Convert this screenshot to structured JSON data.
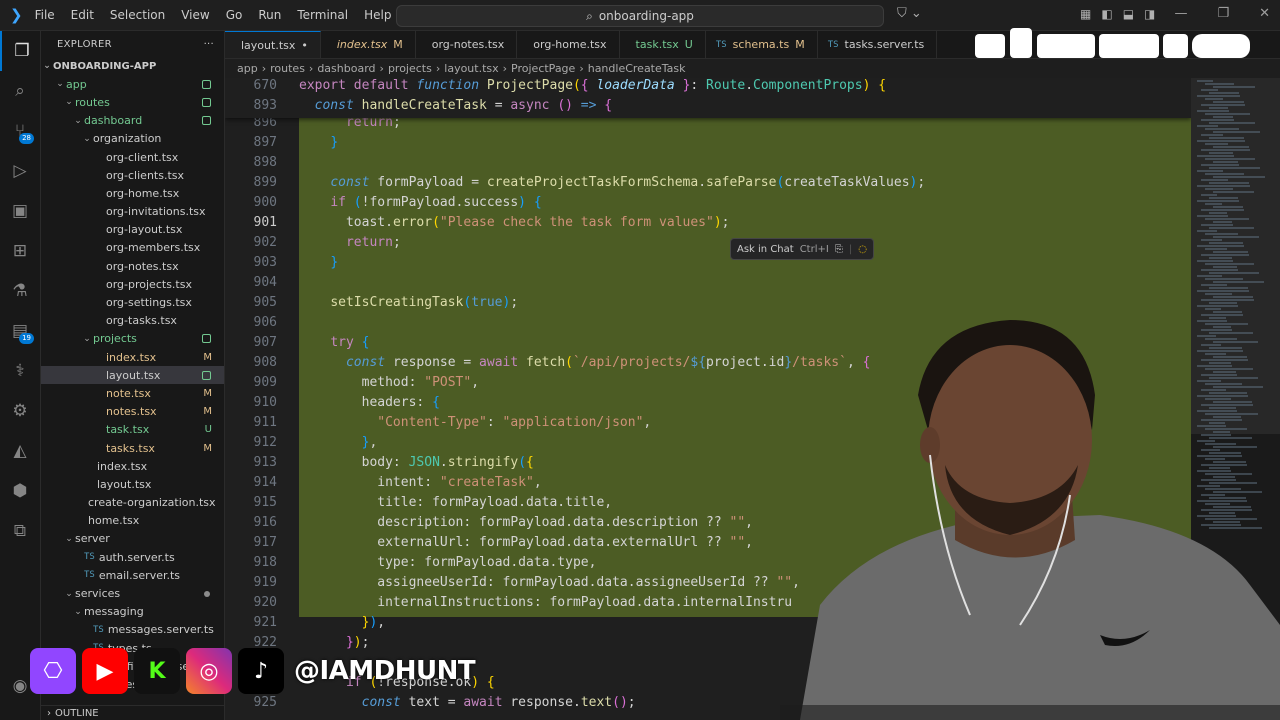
{
  "menu": [
    "File",
    "Edit",
    "Selection",
    "View",
    "Go",
    "Run",
    "Terminal",
    "Help"
  ],
  "search": {
    "text": "onboarding-app"
  },
  "explorer": {
    "title": "EXPLORER",
    "root": "ONBOARDING-APP",
    "tree": [
      {
        "label": "app",
        "depth": 1,
        "type": "folder",
        "open": true,
        "status": "dot"
      },
      {
        "label": "routes",
        "depth": 2,
        "type": "folder",
        "open": true,
        "status": "dot"
      },
      {
        "label": "dashboard",
        "depth": 3,
        "type": "folder",
        "open": true,
        "status": "dot"
      },
      {
        "label": "organization",
        "depth": 4,
        "type": "folder",
        "open": true,
        "status": ""
      },
      {
        "label": "org-client.tsx",
        "depth": 5,
        "type": "file",
        "status": ""
      },
      {
        "label": "org-clients.tsx",
        "depth": 5,
        "type": "file",
        "status": ""
      },
      {
        "label": "org-home.tsx",
        "depth": 5,
        "type": "file",
        "status": ""
      },
      {
        "label": "org-invitations.tsx",
        "depth": 5,
        "type": "file",
        "status": ""
      },
      {
        "label": "org-layout.tsx",
        "depth": 5,
        "type": "file",
        "status": ""
      },
      {
        "label": "org-members.tsx",
        "depth": 5,
        "type": "file",
        "status": ""
      },
      {
        "label": "org-notes.tsx",
        "depth": 5,
        "type": "file",
        "status": ""
      },
      {
        "label": "org-projects.tsx",
        "depth": 5,
        "type": "file",
        "status": ""
      },
      {
        "label": "org-settings.tsx",
        "depth": 5,
        "type": "file",
        "status": ""
      },
      {
        "label": "org-tasks.tsx",
        "depth": 5,
        "type": "file",
        "status": ""
      },
      {
        "label": "projects",
        "depth": 4,
        "type": "folder",
        "open": true,
        "status": "dot"
      },
      {
        "label": "index.tsx",
        "depth": 5,
        "type": "file",
        "status": "M"
      },
      {
        "label": "layout.tsx",
        "depth": 5,
        "type": "file",
        "status": "dot",
        "selected": true
      },
      {
        "label": "note.tsx",
        "depth": 5,
        "type": "file",
        "status": "M"
      },
      {
        "label": "notes.tsx",
        "depth": 5,
        "type": "file",
        "status": "M"
      },
      {
        "label": "task.tsx",
        "depth": 5,
        "type": "file",
        "status": "U"
      },
      {
        "label": "tasks.tsx",
        "depth": 5,
        "type": "file",
        "status": "M"
      },
      {
        "label": "index.tsx",
        "depth": 4,
        "type": "file",
        "status": ""
      },
      {
        "label": "layout.tsx",
        "depth": 4,
        "type": "file",
        "status": ""
      },
      {
        "label": "create-organization.tsx",
        "depth": 3,
        "type": "file",
        "status": ""
      },
      {
        "label": "home.tsx",
        "depth": 3,
        "type": "file",
        "status": ""
      },
      {
        "label": "server",
        "depth": 2,
        "type": "folder",
        "open": true,
        "status": ""
      },
      {
        "label": "auth.server.ts",
        "depth": 3,
        "type": "file",
        "status": ""
      },
      {
        "label": "email.server.ts",
        "depth": 3,
        "type": "file",
        "status": ""
      },
      {
        "label": "services",
        "depth": 2,
        "type": "folder",
        "open": true,
        "status": "gray"
      },
      {
        "label": "messaging",
        "depth": 3,
        "type": "folder",
        "open": true,
        "status": ""
      },
      {
        "label": "messages.server.ts",
        "depth": 4,
        "type": "file",
        "status": ""
      },
      {
        "label": "types.ts",
        "depth": 4,
        "type": "file",
        "status": ""
      },
      {
        "label": "notifications.server.ts",
        "depth": 4,
        "type": "file",
        "status": ""
      },
      {
        "label": "types.ts",
        "depth": 4,
        "type": "file",
        "status": ""
      }
    ],
    "outline": "OUTLINE"
  },
  "activity": {
    "scm_badge": "28",
    "ext_badge": "19"
  },
  "tabs": [
    {
      "label": "layout.tsx",
      "status": "•",
      "active": true
    },
    {
      "label": "index.tsx",
      "status": "M",
      "italic": true
    },
    {
      "label": "org-notes.tsx",
      "status": ""
    },
    {
      "label": "org-home.tsx",
      "status": ""
    },
    {
      "label": "task.tsx",
      "status": "U"
    },
    {
      "label": "schema.ts",
      "status": "M"
    },
    {
      "label": "tasks.server.ts",
      "status": ""
    }
  ],
  "breadcrumbs": [
    "app",
    "routes",
    "dashboard",
    "projects",
    "layout.tsx",
    "ProjectPage",
    "handleCreateTask"
  ],
  "code": {
    "sticky": [
      {
        "ln": "670",
        "html": "<span class='kw2'>export</span> <span class='kw2'>default</span> <span class='kw ital'>function</span> <span class='fn'>ProjectPage</span><span class='br'>(</span><span class='br2'>{</span> <span class='var ital'>loaderData</span> <span class='br2'>}</span><span class='pl'>:</span> <span class='ty'>Route</span><span class='pl'>.</span><span class='ty'>ComponentProps</span><span class='br'>)</span> <span class='br'>{</span>"
      },
      {
        "ln": "893",
        "html": "  <span class='kw ital'>const</span> <span class='fn'>handleCreateTask</span> <span class='pl'>=</span> <span class='kw2'>async</span> <span class='br2'>()</span> <span class='kw'>=&gt;</span> <span class='br2'>{</span>"
      }
    ],
    "lines": [
      {
        "ln": "896",
        "html": "      <span class='kw2'>return</span><span class='pl'>;</span>"
      },
      {
        "ln": "897",
        "html": "    <span class='br3'>}</span>"
      },
      {
        "ln": "898",
        "html": ""
      },
      {
        "ln": "899",
        "html": "    <span class='kw ital'>const</span> <span class='pl'>formPayload</span> <span class='pl'>=</span> <span class='fn'>createProjectTaskFormSchema</span><span class='pl'>.</span><span class='fn'>safeParse</span><span class='br3'>(</span><span class='pl'>createTaskValues</span><span class='br3'>)</span><span class='pl'>;</span>"
      },
      {
        "ln": "900",
        "html": "    <span class='kw2'>if</span> <span class='br3'>(</span><span class='pl'>!</span><span class='pl'>formPayload</span><span class='pl'>.success</span><span class='br3'>)</span> <span class='br3'>{</span>"
      },
      {
        "ln": "901",
        "html": "      <span class='pl'>toast</span><span class='pl'>.</span><span class='fn'>error</span><span class='br'>(</span><span class='str'>\"Please check the task form values\"</span><span class='br'>)</span><span class='pl'>;</span>",
        "current": true
      },
      {
        "ln": "902",
        "html": "      <span class='kw2'>return</span><span class='pl'>;</span>"
      },
      {
        "ln": "903",
        "html": "    <span class='br3'>}</span>"
      },
      {
        "ln": "904",
        "html": ""
      },
      {
        "ln": "905",
        "html": "    <span class='fn'>setIsCreatingTask</span><span class='br3'>(</span><span class='kw'>true</span><span class='br3'>)</span><span class='pl'>;</span>"
      },
      {
        "ln": "906",
        "html": ""
      },
      {
        "ln": "907",
        "html": "    <span class='kw2'>try</span> <span class='br3'>{</span>"
      },
      {
        "ln": "908",
        "html": "      <span class='kw ital'>const</span> <span class='pl'>response</span> <span class='pl'>=</span> <span class='kw2'>await</span> <span class='fn'>fetch</span><span class='br'>(</span><span class='str'>`/api/projects/</span><span class='kw'>${</span><span class='pl'>project.id</span><span class='kw'>}</span><span class='str'>/tasks`</span><span class='pl'>,</span> <span class='br2'>{</span>"
      },
      {
        "ln": "909",
        "html": "        <span class='pl'>method:</span> <span class='str'>\"POST\"</span><span class='pl'>,</span>"
      },
      {
        "ln": "910",
        "html": "        <span class='pl'>headers:</span> <span class='br3'>{</span>"
      },
      {
        "ln": "911",
        "html": "          <span class='str'>\"Content-Type\"</span><span class='pl'>:</span> <span class='str'>\"application/json\"</span><span class='pl'>,</span>"
      },
      {
        "ln": "912",
        "html": "        <span class='br3'>}</span><span class='pl'>,</span>"
      },
      {
        "ln": "913",
        "html": "        <span class='pl'>body:</span> <span class='ty'>JSON</span><span class='pl'>.</span><span class='fn'>stringify</span><span class='br3'>(</span><span class='br'>{</span>"
      },
      {
        "ln": "914",
        "html": "          <span class='pl'>intent:</span> <span class='str'>\"createTask\"</span><span class='pl'>,</span>"
      },
      {
        "ln": "915",
        "html": "          <span class='pl'>title:</span> <span class='pl'>formPayload.data.title</span><span class='pl'>,</span>"
      },
      {
        "ln": "916",
        "html": "          <span class='pl'>description:</span> <span class='pl'>formPayload.data.description</span> <span class='pl'>??</span> <span class='str'>\"\"</span><span class='pl'>,</span>"
      },
      {
        "ln": "917",
        "html": "          <span class='pl'>externalUrl:</span> <span class='pl'>formPayload.data.externalUrl</span> <span class='pl'>??</span> <span class='str'>\"\"</span><span class='pl'>,</span>"
      },
      {
        "ln": "918",
        "html": "          <span class='pl'>type:</span> <span class='pl'>formPayload.data.type</span><span class='pl'>,</span>"
      },
      {
        "ln": "919",
        "html": "          <span class='pl'>assigneeUserId:</span> <span class='pl'>formPayload.data.assigneeUserId</span> <span class='pl'>??</span> <span class='str'>\"\"</span><span class='pl'>,</span>"
      },
      {
        "ln": "920",
        "html": "          <span class='pl'>internalInstructions:</span> <span class='pl'>formPayload.data.internalInstru</span>"
      },
      {
        "ln": "921",
        "html": "        <span class='br'>}</span><span class='br3'>)</span><span class='pl'>,</span>"
      },
      {
        "ln": "922",
        "html": "      <span class='br2'>}</span><span class='br'>)</span><span class='pl'>;</span>"
      },
      {
        "ln": "923",
        "html": ""
      },
      {
        "ln": "924",
        "html": "      <span class='kw2'>if</span> <span class='br'>(</span><span class='pl'>!response.ok</span><span class='br'>)</span> <span class='br'>{</span>"
      },
      {
        "ln": "925",
        "html": "        <span class='kw ital'>const</span> <span class='pl'>text</span> <span class='pl'>=</span> <span class='kw2'>await</span> <span class='pl'>response.</span><span class='fn'>text</span><span class='br2'>()</span><span class='pl'>;</span>"
      }
    ]
  },
  "inline_hint": {
    "label": "Ask in Chat",
    "shortcut": "Ctrl+I"
  },
  "overlay": {
    "handle": "@IAMDHUNT"
  }
}
